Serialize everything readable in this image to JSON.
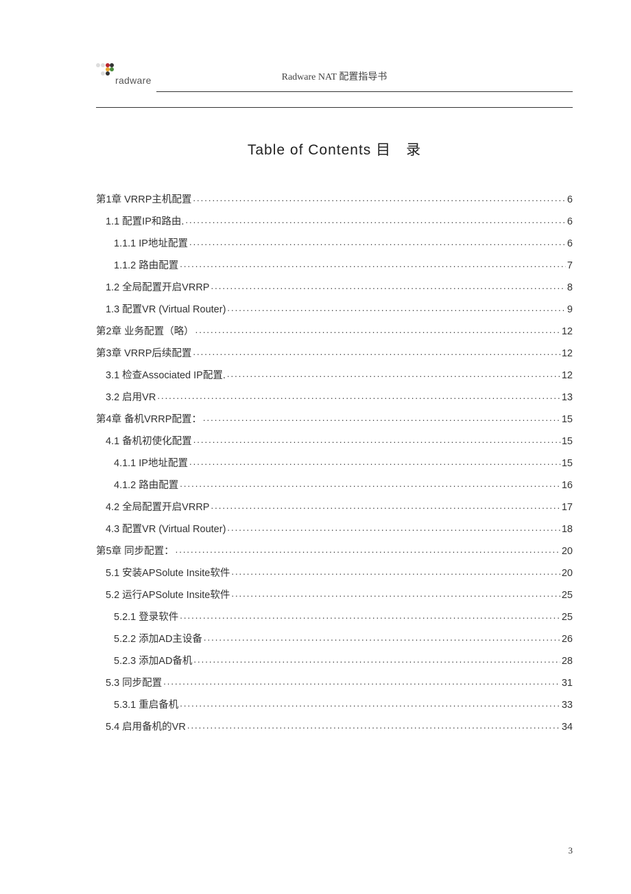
{
  "header": {
    "logo_text": "radware",
    "doc_title": "Radware NAT 配置指导书"
  },
  "toc_title": "Table of Contents 目　录",
  "toc": [
    {
      "level": 1,
      "label": "第1章  VRRP主机配置",
      "page": "6"
    },
    {
      "level": 2,
      "label": "1.1  配置IP和路由.",
      "page": "6"
    },
    {
      "level": 3,
      "label": "1.1.1 IP地址配置",
      "page": "6"
    },
    {
      "level": 3,
      "label": "1.1.2 路由配置",
      "page": "7"
    },
    {
      "level": 2,
      "label": "1.2  全局配置开启VRRP",
      "page": "8"
    },
    {
      "level": 2,
      "label": "1.3  配置VR (Virtual Router)",
      "page": "9"
    },
    {
      "level": 1,
      "label": "第2章  业务配置（略）",
      "page": "12"
    },
    {
      "level": 1,
      "label": "第3章  VRRP后续配置",
      "page": "12"
    },
    {
      "level": 2,
      "label": "3.1  检查Associated IP配置.",
      "page": "12"
    },
    {
      "level": 2,
      "label": "3.2  启用VR",
      "page": "13"
    },
    {
      "level": 1,
      "label": "第4章  备机VRRP配置：",
      "page": "15"
    },
    {
      "level": 2,
      "label": "4.1  备机初使化配置",
      "page": "15"
    },
    {
      "level": 3,
      "label": "4.1.1 IP地址配置",
      "page": "15"
    },
    {
      "level": 3,
      "label": "4.1.2 路由配置",
      "page": "16"
    },
    {
      "level": 2,
      "label": "4.2  全局配置开启VRRP",
      "page": "17"
    },
    {
      "level": 2,
      "label": "4.3  配置VR (Virtual Router)",
      "page": "18"
    },
    {
      "level": 1,
      "label": "第5章  同步配置：",
      "page": "20"
    },
    {
      "level": 2,
      "label": "5.1  安装APSolute Insite软件",
      "page": "20"
    },
    {
      "level": 2,
      "label": "5.2  运行APSolute Insite软件",
      "page": "25"
    },
    {
      "level": 3,
      "label": "5.2.1 登录软件",
      "page": "25"
    },
    {
      "level": 3,
      "label": "5.2.2 添加AD主设备",
      "page": "26"
    },
    {
      "level": 3,
      "label": "5.2.3 添加AD备机",
      "page": "28"
    },
    {
      "level": 2,
      "label": "5.3  同步配置",
      "page": "31"
    },
    {
      "level": 3,
      "label": "5.3.1 重启备机",
      "page": "33"
    },
    {
      "level": 2,
      "label": "5.4  启用备机的VR",
      "page": "34"
    }
  ],
  "page_number": "3"
}
